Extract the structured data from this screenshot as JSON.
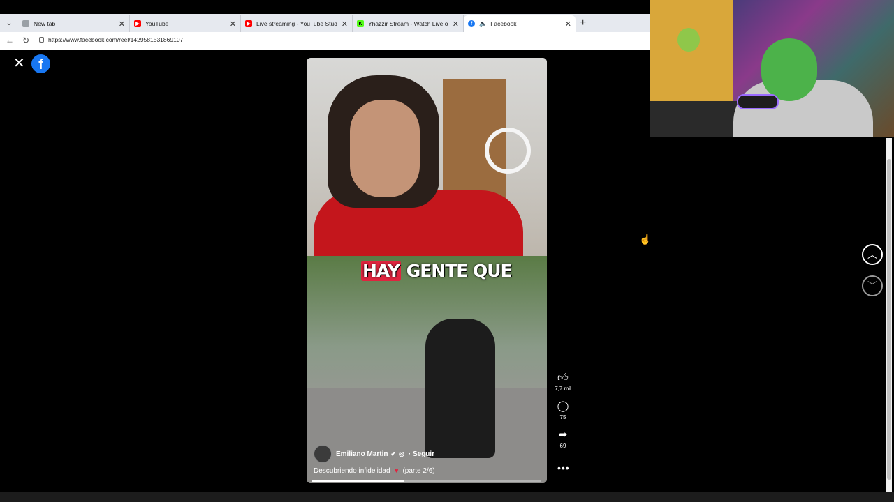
{
  "browser": {
    "tabs": [
      {
        "label": "New tab",
        "icon": "newtab-icon",
        "color": "#9aa0a6"
      },
      {
        "label": "YouTube",
        "icon": "youtube-icon",
        "color": "#ff0000"
      },
      {
        "label": "Live streaming - YouTube Studio",
        "icon": "youtube-studio-icon",
        "color": "#ff0000"
      },
      {
        "label": "Yhazzir Stream - Watch Live on Ki",
        "icon": "kick-icon",
        "color": "#53fc18"
      },
      {
        "label": "Facebook",
        "icon": "facebook-icon",
        "color": "#1877f2"
      }
    ],
    "url": "https://www.facebook.com/reel/1429581531869107"
  },
  "reel": {
    "caption_highlight": "HAY",
    "caption_rest": " GENTE QUE",
    "author": "Emiliano Martin",
    "follow_label": "· Seguir",
    "description": "Descubriendo infidelidad",
    "description_suffix": "(parte 2/6)",
    "progress": 0.4,
    "likes": "7,7 mil",
    "comments": "75",
    "shares": "69"
  },
  "colors": {
    "facebook_blue": "#1877f2",
    "accent_red": "#e0243f"
  }
}
